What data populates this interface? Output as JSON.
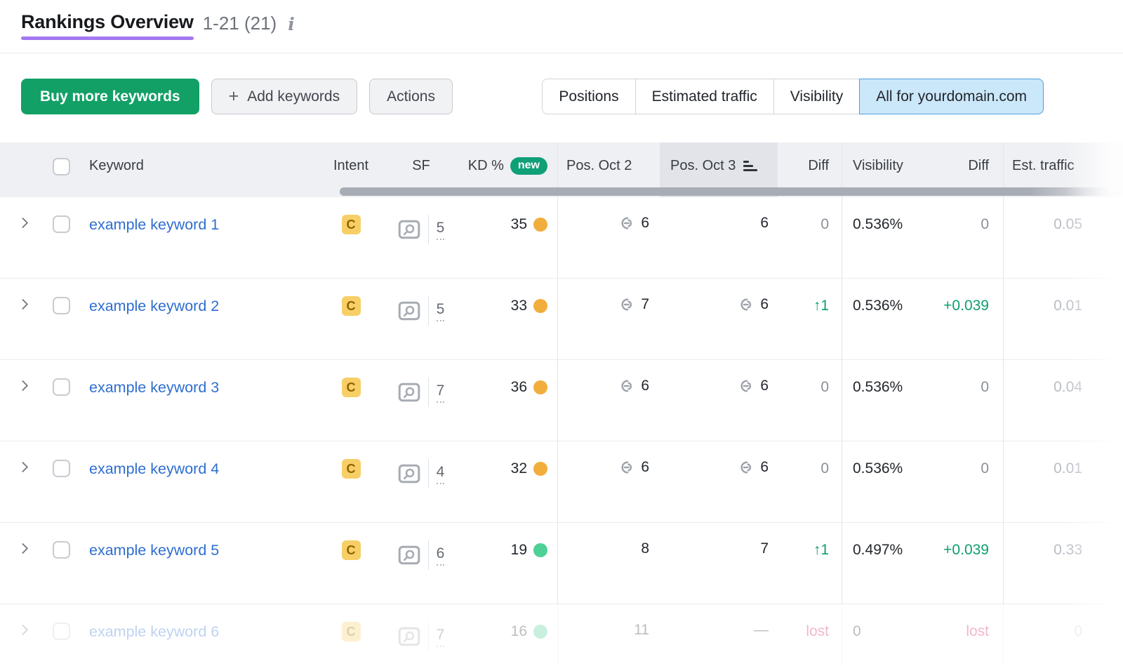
{
  "page": {
    "title": "Rankings Overview",
    "count_label": "1-21 (21)"
  },
  "toolbar": {
    "buy_more": "Buy more keywords",
    "add_keywords": "Add keywords",
    "actions": "Actions",
    "segments": [
      {
        "label": "Positions",
        "selected": false
      },
      {
        "label": "Estimated traffic",
        "selected": false
      },
      {
        "label": "Visibility",
        "selected": false
      },
      {
        "label": "All for yourdomain.com",
        "selected": true
      }
    ]
  },
  "table": {
    "headers": {
      "keyword": "Keyword",
      "intent": "Intent",
      "sf": "SF",
      "kd": "KD %",
      "kd_badge": "new",
      "pos_a": "Pos. Oct 2",
      "pos_b": "Pos. Oct 3",
      "diff_a": "Diff",
      "visibility": "Visibility",
      "diff_b": "Diff",
      "est_traffic": "Est. traffic"
    },
    "sorted_column": "Pos. Oct 3",
    "rows": [
      {
        "keyword": "example keyword 1",
        "intent": "C",
        "sf": "5",
        "kd": "35",
        "kd_dot": "orange",
        "pos_a": {
          "text": "6",
          "link": true
        },
        "pos_b": {
          "text": "6",
          "link": false
        },
        "diff_a": {
          "text": "0",
          "tone": "neutral"
        },
        "visibility": "0.536%",
        "diff_b": {
          "text": "0",
          "tone": "neutral"
        },
        "est": "0.05",
        "faded": false
      },
      {
        "keyword": "example keyword 2",
        "intent": "C",
        "sf": "5",
        "kd": "33",
        "kd_dot": "orange",
        "pos_a": {
          "text": "7",
          "link": true
        },
        "pos_b": {
          "text": "6",
          "link": true
        },
        "diff_a": {
          "text": "↑1",
          "tone": "up"
        },
        "visibility": "0.536%",
        "diff_b": {
          "text": "+0.039",
          "tone": "up"
        },
        "est": "0.01",
        "faded": false
      },
      {
        "keyword": "example keyword 3",
        "intent": "C",
        "sf": "7",
        "kd": "36",
        "kd_dot": "orange",
        "pos_a": {
          "text": "6",
          "link": true
        },
        "pos_b": {
          "text": "6",
          "link": true
        },
        "diff_a": {
          "text": "0",
          "tone": "neutral"
        },
        "visibility": "0.536%",
        "diff_b": {
          "text": "0",
          "tone": "neutral"
        },
        "est": "0.04",
        "faded": false
      },
      {
        "keyword": "example keyword 4",
        "intent": "C",
        "sf": "4",
        "kd": "32",
        "kd_dot": "orange",
        "pos_a": {
          "text": "6",
          "link": true
        },
        "pos_b": {
          "text": "6",
          "link": true
        },
        "diff_a": {
          "text": "0",
          "tone": "neutral"
        },
        "visibility": "0.536%",
        "diff_b": {
          "text": "0",
          "tone": "neutral"
        },
        "est": "0.01",
        "faded": false
      },
      {
        "keyword": "example keyword 5",
        "intent": "C",
        "sf": "6",
        "kd": "19",
        "kd_dot": "green",
        "pos_a": {
          "text": "8",
          "link": false
        },
        "pos_b": {
          "text": "7",
          "link": false
        },
        "diff_a": {
          "text": "↑1",
          "tone": "up"
        },
        "visibility": "0.497%",
        "diff_b": {
          "text": "+0.039",
          "tone": "up"
        },
        "est": "0.33",
        "faded": false
      },
      {
        "keyword": "example keyword 6",
        "intent": "C",
        "sf": "7",
        "kd": "16",
        "kd_dot": "green",
        "pos_a": {
          "text": "11",
          "link": false
        },
        "pos_b": {
          "text": "—",
          "link": false
        },
        "diff_a": {
          "text": "lost",
          "tone": "lost"
        },
        "visibility": "0",
        "diff_b": {
          "text": "lost",
          "tone": "lost"
        },
        "est": "0",
        "faded": true
      }
    ]
  },
  "colors": {
    "accent_green": "#12a066",
    "new_badge_green": "#10a078",
    "selected_tab_bg": "#cbe7fa",
    "selected_tab_border": "#4d9edd",
    "title_underline": "#a379f1",
    "link_blue": "#2e6ed0",
    "kd_orange": "#f2ae3c",
    "kd_green": "#4ed196",
    "diff_up": "#0e9e6d",
    "diff_lost": "#d1184b",
    "intent_badge_bg": "#f7cf66",
    "intent_badge_text": "#946200"
  }
}
